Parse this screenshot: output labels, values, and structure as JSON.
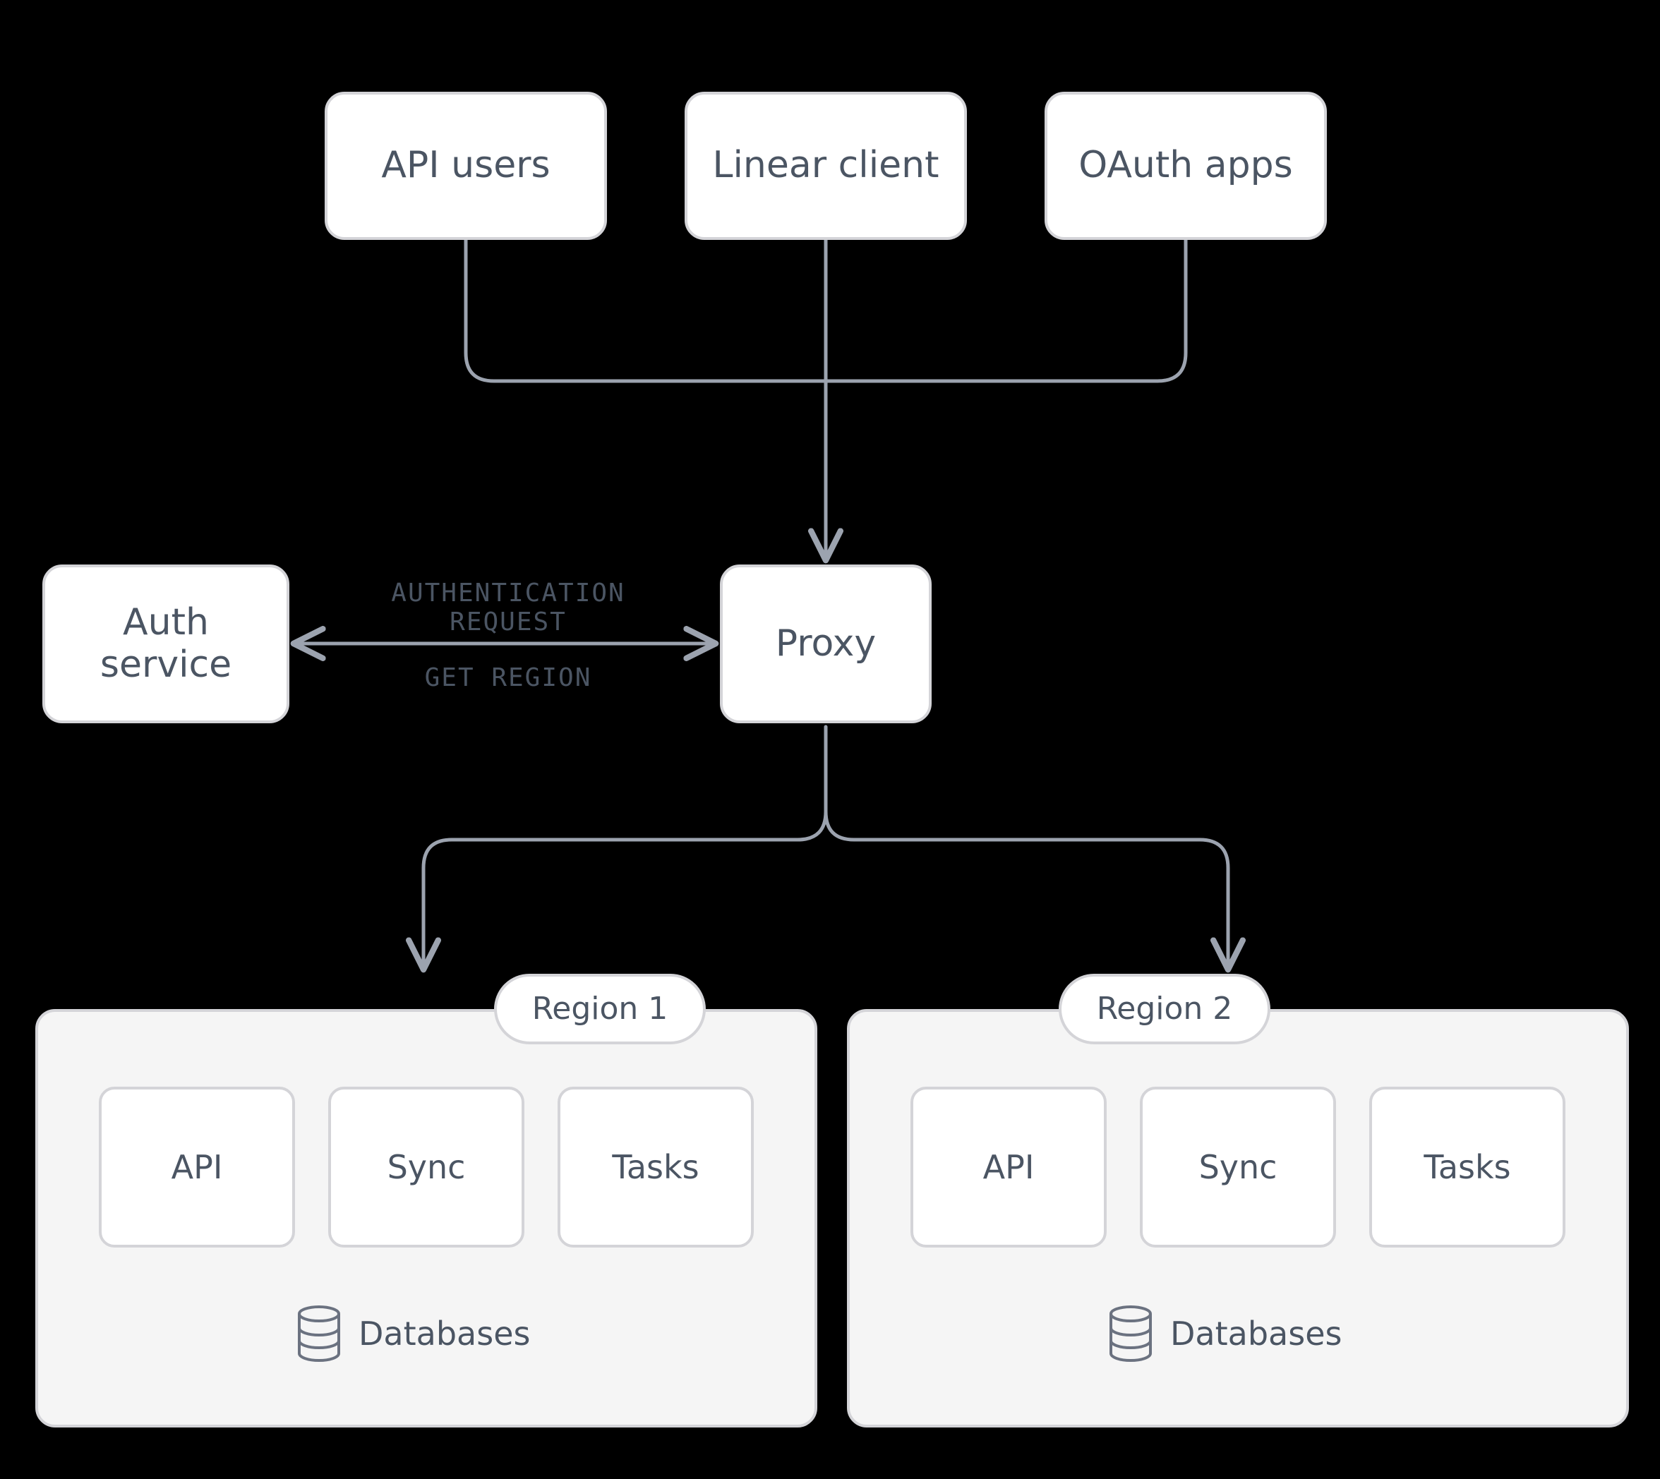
{
  "clients": {
    "api_users": "API users",
    "linear_client": "Linear client",
    "oauth_apps": "OAuth apps"
  },
  "auth_service": "Auth\nservice",
  "proxy": "Proxy",
  "edge": {
    "auth_top": "AUTHENTICATION REQUEST",
    "auth_bottom": "GET REGION"
  },
  "regions": [
    {
      "title": "Region 1",
      "services": [
        "API",
        "Sync",
        "Tasks"
      ],
      "db_label": "Databases"
    },
    {
      "title": "Region 2",
      "services": [
        "API",
        "Sync",
        "Tasks"
      ],
      "db_label": "Databases"
    }
  ]
}
